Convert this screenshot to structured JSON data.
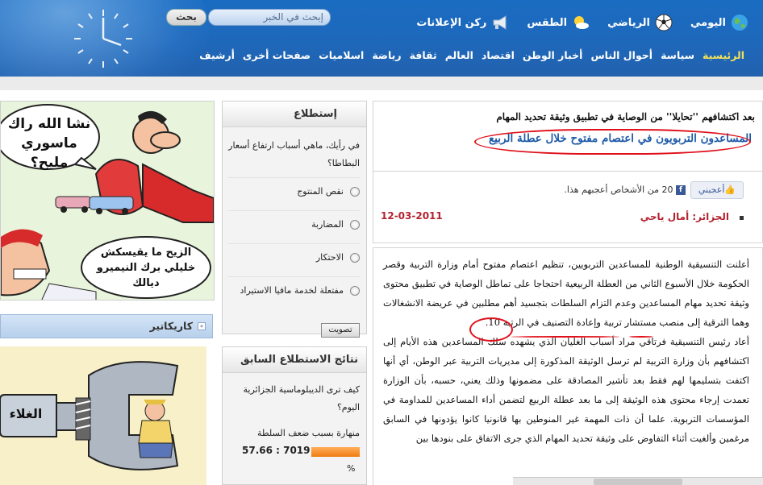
{
  "header": {
    "search": {
      "button_label": "بحث",
      "placeholder": "إبحث في الخبر"
    },
    "top_links": [
      {
        "label": "اليومي",
        "icon": "globe-icon"
      },
      {
        "label": "الرياضي",
        "icon": "soccer-ball-icon"
      },
      {
        "label": "الطقس",
        "icon": "sun-cloud-icon"
      },
      {
        "label": "ركن الإعلانات",
        "icon": "megaphone-icon"
      }
    ],
    "nav": [
      "الرئيسية",
      "سياسة",
      "أحوال الناس",
      "أخبار الوطن",
      "اقتصاد",
      "العالم",
      "ثقافة",
      "رياضة",
      "اسلاميات",
      "صفحات أخرى",
      "أرشيف"
    ],
    "colors": {
      "header_blue": "#1e68bb",
      "nav_active": "#f1e25a",
      "headline_blue": "#1e5aa8",
      "annotation_red": "#e0101a"
    }
  },
  "article": {
    "kicker": "بعد اكتشافهم ''تحايلا'' من الوصاية في تطبيق وثيقة تحديد المهام",
    "headline": "المساعدون التربويون في اعتصام مفتوح خلال عطلة الربيع",
    "like_button": "أعجبني",
    "like_text": "20 من الأشخاص أعجبهم هذا.",
    "author": "الجزائر: أمال ياحي",
    "date": "12-03-2011",
    "paragraphs": [
      "أعلنت التنسيقية الوطنية للمساعدين التربويين، تنظيم اعتصام مفتوح أمام وزارة التربية وقصر الحكومة خلال الأسبوع الثاني من العطلة الربيعية احتجاجا على تماطل الوصاية في تطبيق محتوى وثيقة تحديد مهام المساعدين وعدم التزام السلطات بتجسيد أهم مطلبين في عريضة الانشغالات وهما الترقية إلى منصب مستشار تربية وإعادة التصنيف في الرتبة 10.",
      "أعاد رئيس التنسيقية فرتاقي مراد أسباب الغليان الذي يشهده سلك المساعدين هذه الأيام إلى اكتشافهم بأن وزارة التربية لم ترسل الوثيقة المذكورة إلى مديريات التربية عبر الوطن، أي أنها اكتفت بتسليمها لهم فقط بعد تأشير المصادقة على مضمونها وذلك يعني، حسبه، بأن الوزارة تعمدت إرجاء محتوى هذه الوثيقة إلى ما بعد عطلة الربيع لتضمن أداء المساعدين للمداومة في المؤسسات التربوية. علما أن ذات المهمة غير المنوطين بها قانونيا كانوا يؤدونها في السابق مرغمين وألغيت أثناء التفاوض على وثيقة تحديد المهام الذي جرى الاتفاق على بنودها بين"
    ]
  },
  "poll": {
    "title": "إستطلاع",
    "question": "في رأيك، ماهي أسباب ارتفاع أسعار البطاطا؟",
    "options": [
      "نقص المنتوج",
      "المضاربة",
      "الاحتكار",
      "مفتعلة لخدمة مافيا الاستيراد"
    ],
    "vote_button": "تصويت"
  },
  "poll_results": {
    "title": "نتائج الاستطلاع السابق",
    "question": "كيف ترى الديبلوماسية الجزائرية اليوم؟",
    "answer_label": "منهارة بسبب ضعف السلطة",
    "answer_value": "57.66 : 7019",
    "answer_percent": 57.66,
    "pct_symbol": "%"
  },
  "cartoons": {
    "top_bubble_1": "نشا الله راك ماسوري مليح؟",
    "top_bubble_2": "الزيح ما يقيسكش خليلي برك النيميرو ديالك",
    "section_title": "كاريكاتير",
    "bottom_label": "الغلاء"
  }
}
